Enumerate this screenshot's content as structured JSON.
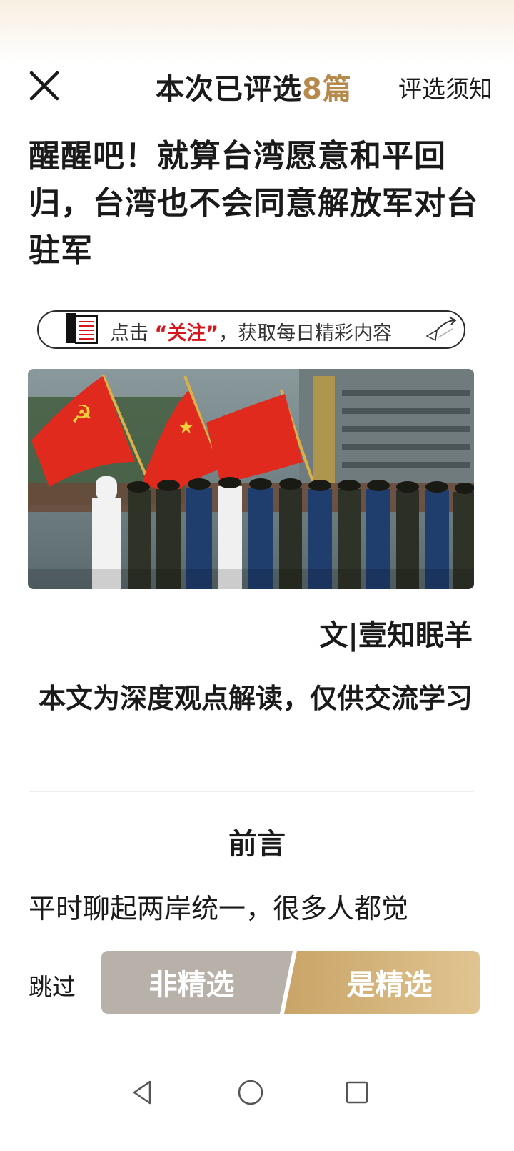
{
  "header": {
    "title_prefix": "本次已评选",
    "count": "8篇",
    "guide_label": "评选须知"
  },
  "article": {
    "title": "醒醒吧！就算台湾愿意和平回归，台湾也不会同意解放军对台驻军",
    "follow_banner": {
      "prefix": "点击",
      "highlight": "“关注”",
      "suffix": "，获取每日精彩内容"
    },
    "author": "文|壹知眠羊",
    "disclaimer": "本文为深度观点解读，仅供交流学习",
    "section_heading": "前言",
    "paragraph": "平时聊起两岸统一，很多人都觉"
  },
  "actions": {
    "skip_label": "跳过",
    "non_select_label": "非精选",
    "select_label": "是精选"
  },
  "colors": {
    "accent_gold": "#b58a4c",
    "non_select_bg": "#b8b1a9",
    "select_bg_start": "#c9a468",
    "select_bg_end": "#e0c490",
    "highlight_red": "#d5161b"
  },
  "icons": {
    "close": "close-icon",
    "book": "book-icon",
    "pointer": "pointer-icon",
    "nav_back": "back-triangle-icon",
    "nav_home": "home-circle-icon",
    "nav_recents": "recents-square-icon"
  }
}
